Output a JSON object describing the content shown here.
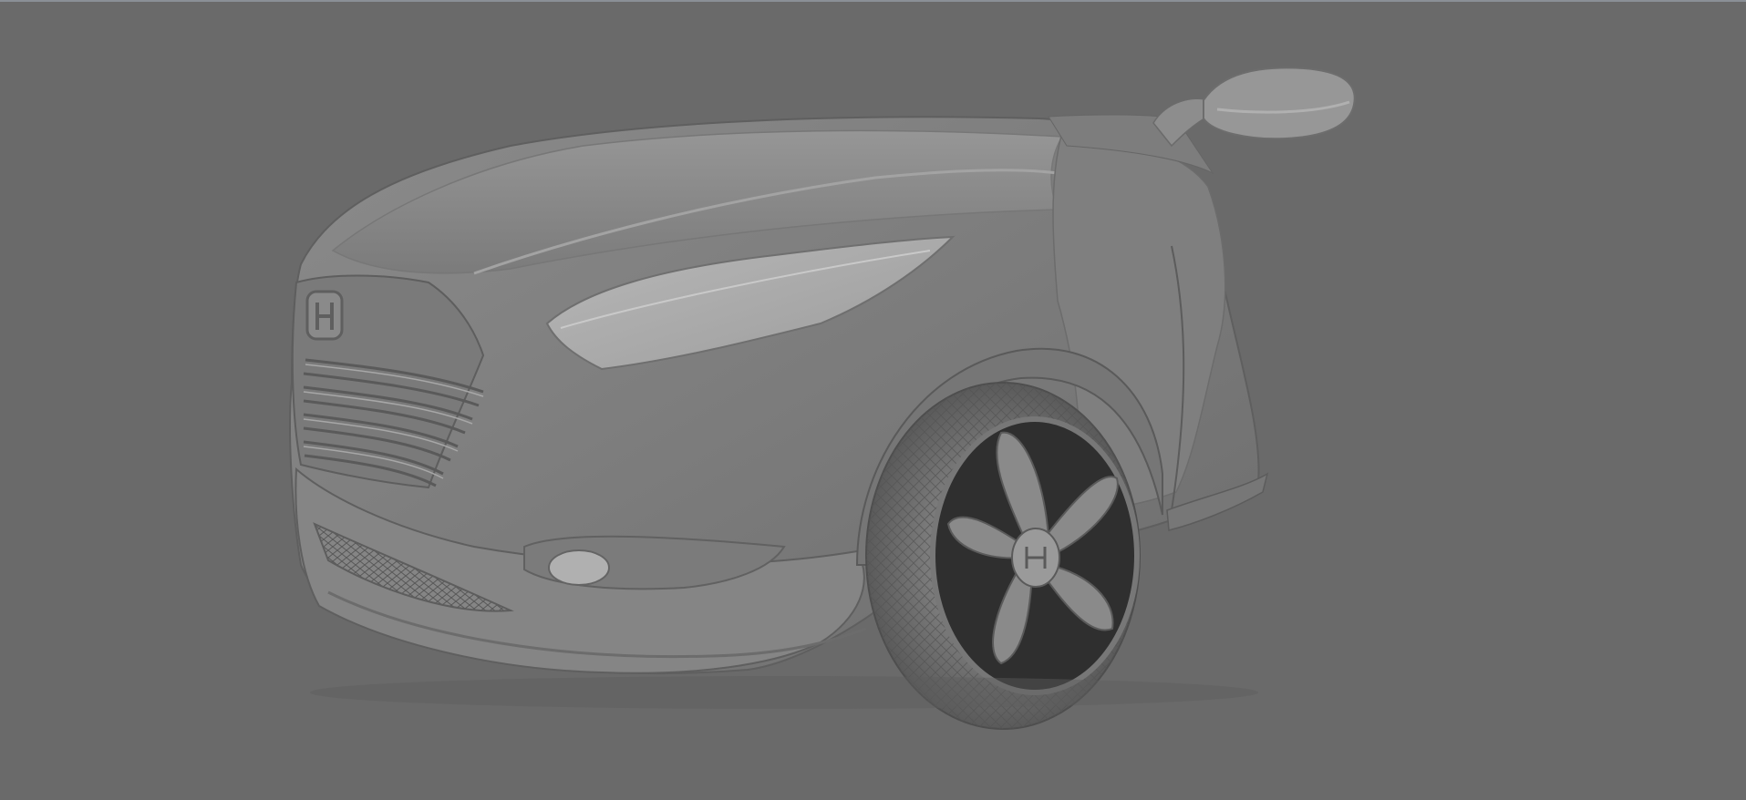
{
  "viewport": {
    "background_color": "#6a6a6a",
    "top_strip_color": "#8a8f96"
  },
  "model": {
    "subject": "car-front-quarter",
    "shading_color": "#8e8e8e",
    "highlight_color": "#a6a6a6",
    "shadow_color": "#6f6f6f",
    "dark_detail_color": "#2f2f2f",
    "wireframe_color": "#4e4e4e"
  }
}
